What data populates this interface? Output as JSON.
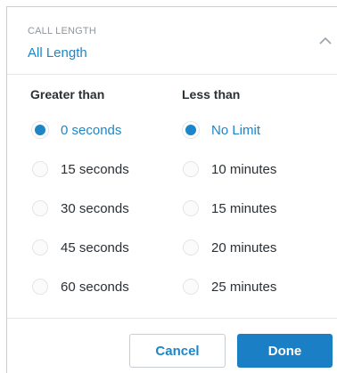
{
  "header": {
    "caption": "CALL LENGTH",
    "value": "All Length"
  },
  "columns": {
    "greater": {
      "heading": "Greater than",
      "options": [
        {
          "label": "0 seconds",
          "selected": true
        },
        {
          "label": "15 seconds",
          "selected": false
        },
        {
          "label": "30 seconds",
          "selected": false
        },
        {
          "label": "45 seconds",
          "selected": false
        },
        {
          "label": "60 seconds",
          "selected": false
        }
      ]
    },
    "less": {
      "heading": "Less than",
      "options": [
        {
          "label": "No Limit",
          "selected": true
        },
        {
          "label": "10 minutes",
          "selected": false
        },
        {
          "label": "15 minutes",
          "selected": false
        },
        {
          "label": "20 minutes",
          "selected": false
        },
        {
          "label": "25 minutes",
          "selected": false
        }
      ]
    }
  },
  "footer": {
    "cancel_label": "Cancel",
    "done_label": "Done"
  },
  "colors": {
    "accent": "#1c86c8",
    "primary_button": "#1a7fc5",
    "text": "#2b3035",
    "muted": "#8e979e"
  }
}
